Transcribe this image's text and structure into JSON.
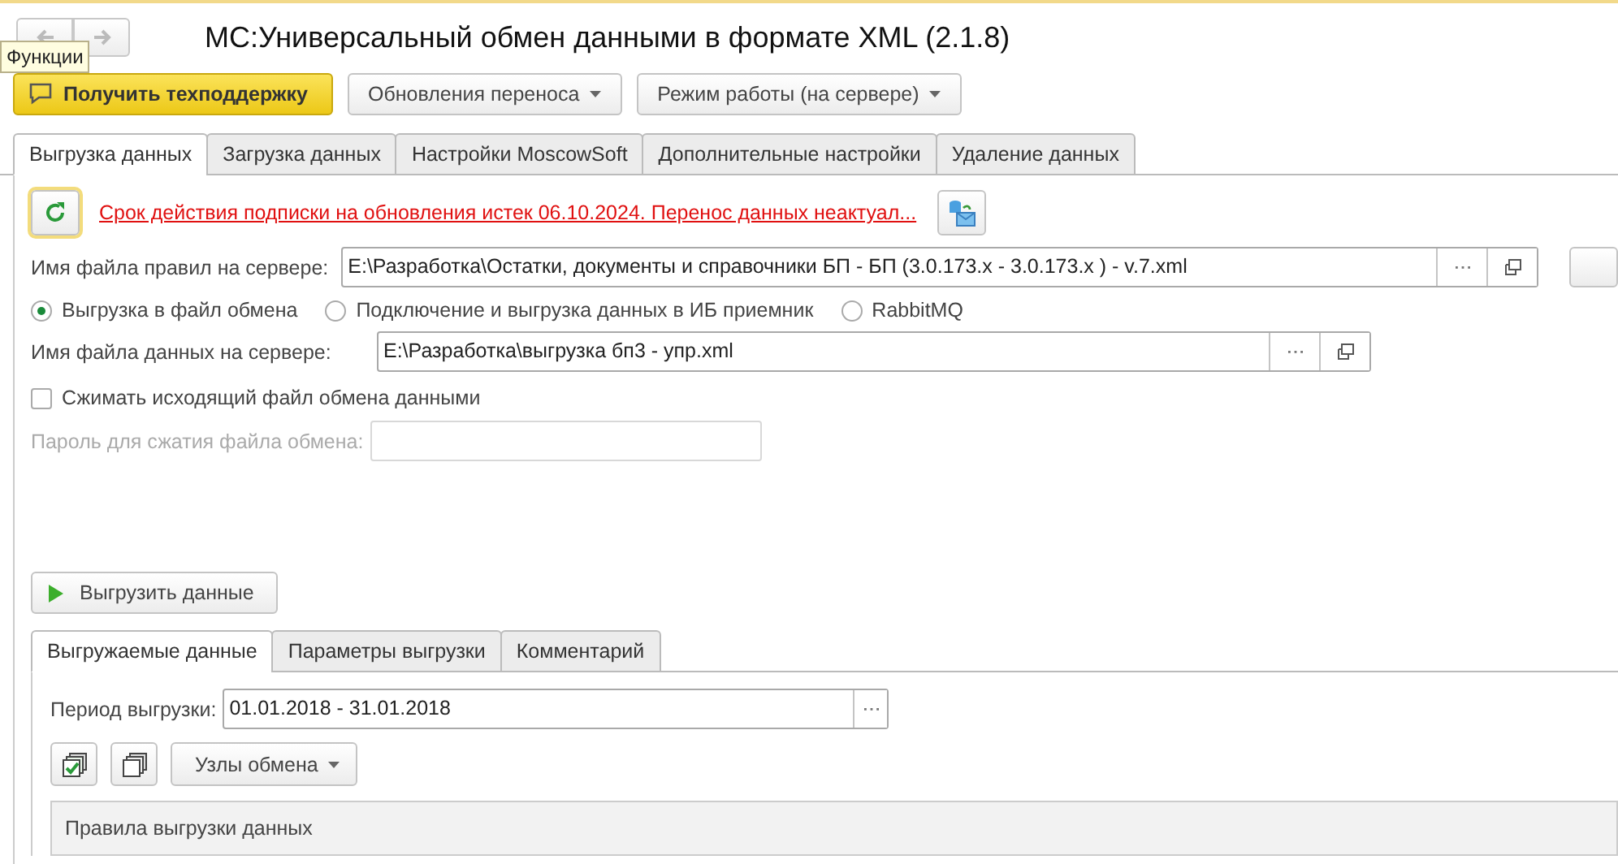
{
  "nav": {
    "tooltip": "Функции"
  },
  "window": {
    "title": "МС:Универсальный обмен данными в формате XML (2.1.8)"
  },
  "toolbar": [
    {
      "kind": "primary",
      "label": "Получить техподдержку"
    },
    {
      "kind": "dropdown",
      "label": "Обновления переноса"
    },
    {
      "kind": "dropdown",
      "label": "Режим работы (на сервере)"
    }
  ],
  "tabs": [
    {
      "label": "Выгрузка данных",
      "selected": true
    },
    {
      "label": "Загрузка данных",
      "selected": false
    },
    {
      "label": "Настройки MoscowSoft",
      "selected": false
    },
    {
      "label": "Дополнительные настройки",
      "selected": false
    },
    {
      "label": "Удаление данных",
      "selected": false
    }
  ],
  "notice": {
    "link": "Срок действия подписки на обновления истек 06.10.2024. Перенос данных неактуал..."
  },
  "rules_file": {
    "label": "Имя файла правил на сервере:",
    "value": "E:\\Разработка\\Остатки, документы и справочники БП - БП (3.0.173.x - 3.0.173.x ) - v.7.xml"
  },
  "export_modes": [
    {
      "label": "Выгрузка в файл обмена",
      "selected": true
    },
    {
      "label": "Подключение и выгрузка данных в ИБ приемник",
      "selected": false
    },
    {
      "label": "RabbitMQ",
      "selected": false
    }
  ],
  "data_file": {
    "label": "Имя файла данных на сервере:",
    "value": "E:\\Разработка\\выгрузка бп3 - упр.xml"
  },
  "compress": {
    "label": "Сжимать исходящий файл обмена данными",
    "checked": false
  },
  "password": {
    "label": "Пароль для сжатия файла обмена:",
    "disabled": true
  },
  "run_button": {
    "label": "Выгрузить данные"
  },
  "sub_tabs": [
    {
      "label": "Выгружаемые данные",
      "selected": true
    },
    {
      "label": "Параметры выгрузки",
      "selected": false
    },
    {
      "label": "Комментарий",
      "selected": false
    }
  ],
  "period": {
    "label": "Период выгрузки:",
    "value": "01.01.2018 - 31.01.2018"
  },
  "nodes_button": {
    "label": "Узлы обмена"
  },
  "table": {
    "columns": [
      "Правила выгрузки данных"
    ]
  }
}
